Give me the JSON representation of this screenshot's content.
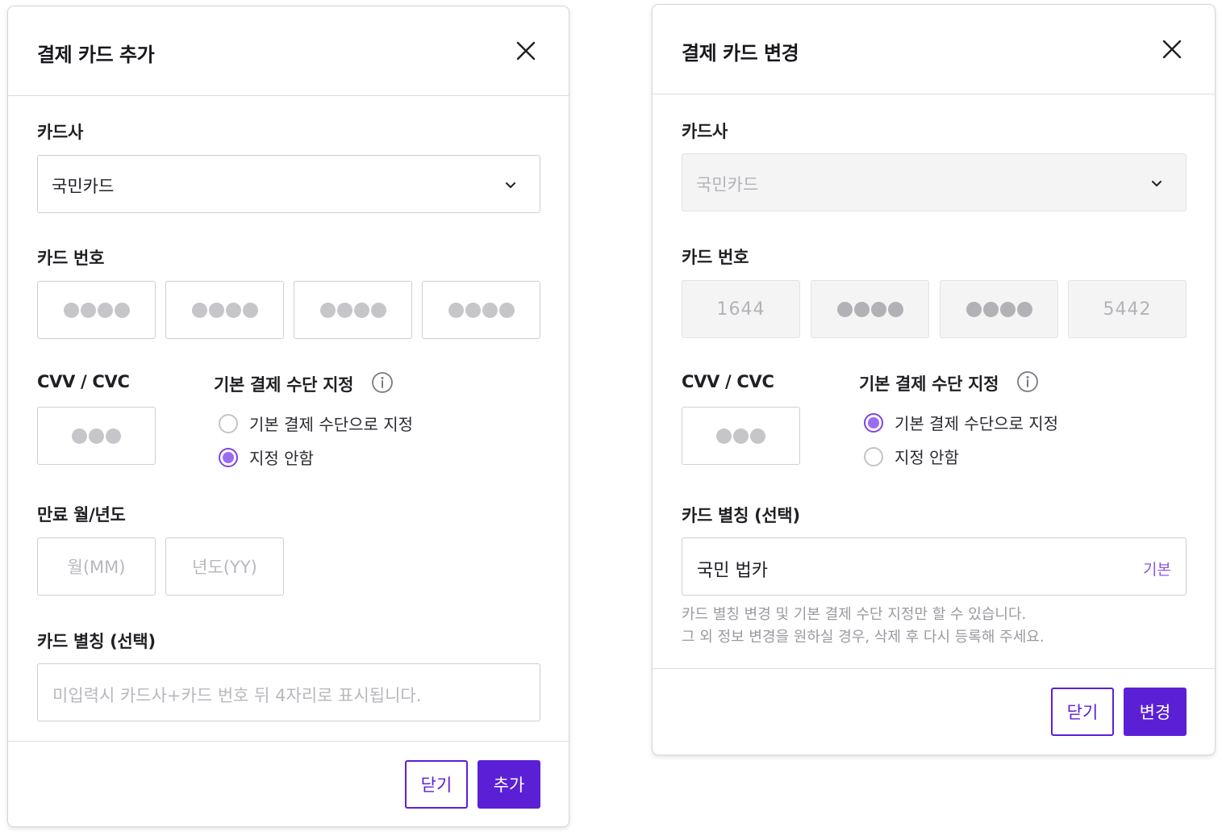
{
  "add_modal": {
    "title": "결제 카드 추가",
    "card_company_label": "카드사",
    "card_company_value": "국민카드",
    "card_number_label": "카드 번호",
    "cvv_label": "CVV / CVC",
    "default_method_label": "기본 결제 수단 지정",
    "radio_set_default": "기본 결제 수단으로 지정",
    "radio_no_default": "지정 안함",
    "selected_radio": "지정 안함",
    "expiry_label": "만료 월/년도",
    "month_placeholder": "월(MM)",
    "year_placeholder": "년도(YY)",
    "nickname_label": "카드 별칭 (선택)",
    "nickname_placeholder": "미입력시 카드사+카드 번호 뒤 4자리로 표시됩니다.",
    "close_button": "닫기",
    "submit_button": "추가"
  },
  "edit_modal": {
    "title": "결제 카드 변경",
    "card_company_label": "카드사",
    "card_company_value": "국민카드",
    "card_number_label": "카드 번호",
    "card_number_first": "1644",
    "card_number_last": "5442",
    "cvv_label": "CVV / CVC",
    "default_method_label": "기본 결제 수단 지정",
    "radio_set_default": "기본 결제 수단으로 지정",
    "radio_no_default": "지정 안함",
    "selected_radio": "기본 결제 수단으로 지정",
    "nickname_label": "카드 별칭 (선택)",
    "nickname_value": "국민 법카",
    "nickname_suffix": "기본",
    "help_line1": "카드 별칭 변경 및 기본 결제 수단 지정만 할 수 있습니다.",
    "help_line2": "그 외 정보 변경을 원하실 경우, 삭제 후 다시 등록해 주세요.",
    "close_button": "닫기",
    "submit_button": "변경"
  },
  "icons": {
    "close": "close-icon",
    "chevron": "chevron-down-icon",
    "info": "info-icon"
  },
  "colors": {
    "primary": "#5b20d6",
    "radio_checked": "#9b6cf0",
    "disabled_bg": "#f4f4f5"
  }
}
